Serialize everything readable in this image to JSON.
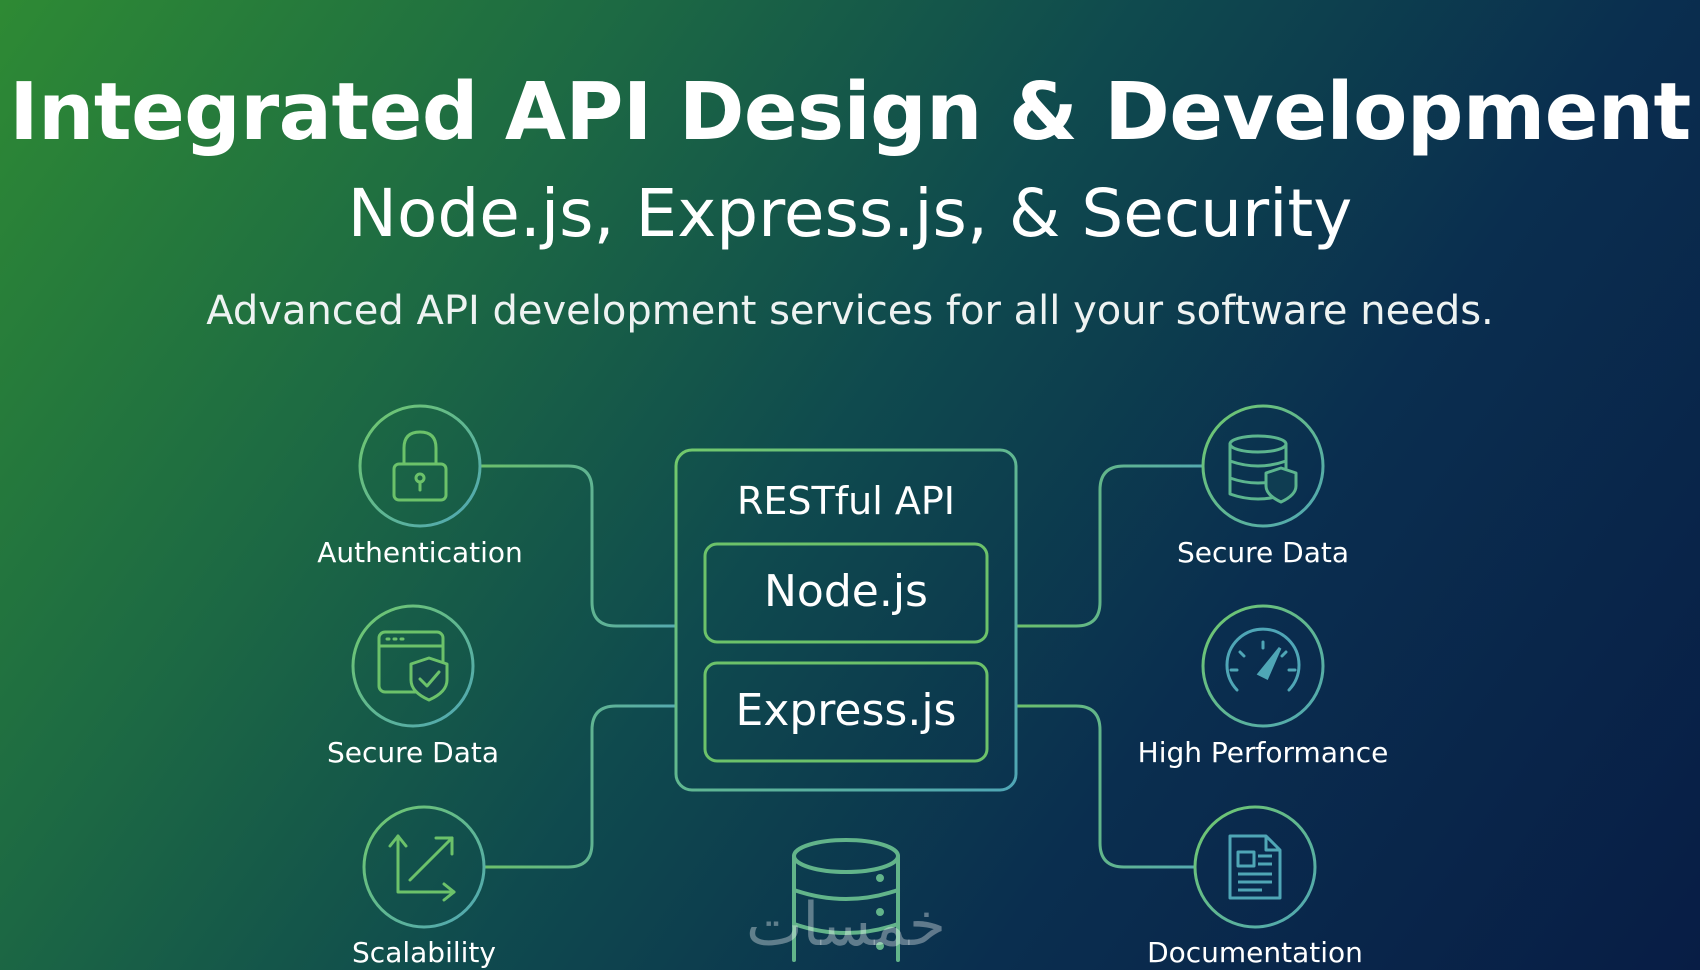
{
  "header": {
    "title": "Integrated API Design & Development",
    "subtitle": "Node.js, Express.js, & Security",
    "tagline": "Advanced API development services for all your software needs."
  },
  "center": {
    "label": "RESTful API",
    "blocks": [
      "Node.js",
      "Express.js"
    ]
  },
  "features_left": [
    {
      "label": "Authentication",
      "icon": "lock-icon"
    },
    {
      "label": "Secure Data",
      "icon": "browser-shield-icon"
    },
    {
      "label": "Scalability",
      "icon": "scale-arrow-icon"
    }
  ],
  "features_right": [
    {
      "label": "Secure Data",
      "icon": "database-shield-icon"
    },
    {
      "label": "High Performance",
      "icon": "speedometer-icon"
    },
    {
      "label": "Documentation",
      "icon": "document-icon"
    }
  ],
  "bottom_icon": "database-icon",
  "watermark": "خمسات",
  "colors": {
    "line_green": "#6cc06a",
    "line_teal": "#55aab2",
    "text_light": "#ffffff"
  }
}
